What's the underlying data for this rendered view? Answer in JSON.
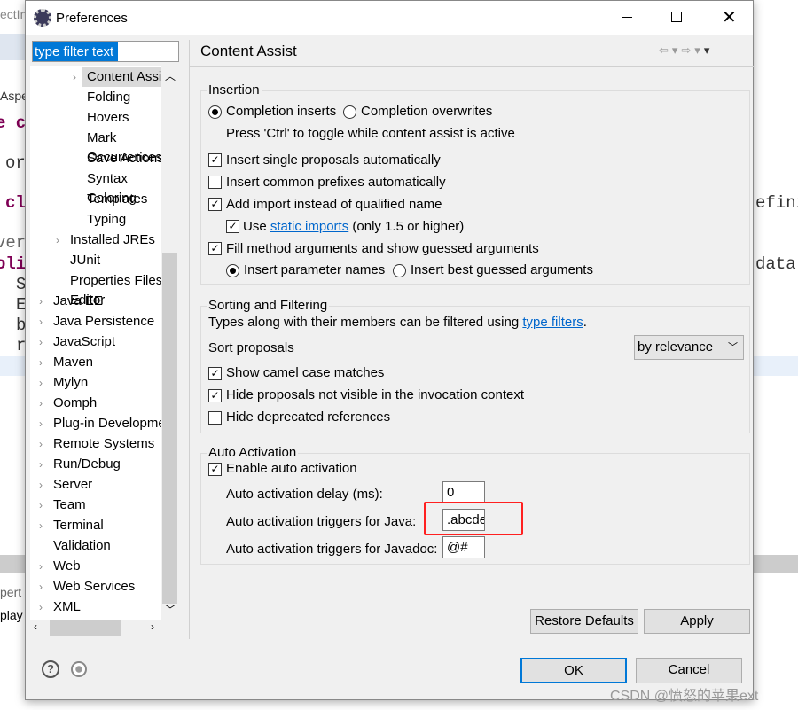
{
  "background": {
    "left_fragments": [
      "ectIn",
      "Aspe",
      "e c",
      "or",
      "cl",
      "ver",
      "oli",
      "S",
      "E",
      "b",
      "r",
      "pert",
      "play"
    ],
    "right_fragments": [
      "efini",
      "data,"
    ]
  },
  "dialog": {
    "title": "Preferences",
    "filter_placeholder": "type filter text",
    "filter_value": "type filter text"
  },
  "tree": {
    "items": [
      {
        "label": "Content Assist",
        "expandable": true,
        "selected": true
      },
      {
        "label": "Folding"
      },
      {
        "label": "Hovers"
      },
      {
        "label": "Mark Occurrences"
      },
      {
        "label": "Save Actions"
      },
      {
        "label": "Syntax Coloring"
      },
      {
        "label": "Templates"
      },
      {
        "label": "Typing"
      },
      {
        "label": "Installed JREs",
        "expandable": true
      },
      {
        "label": "JUnit"
      },
      {
        "label": "Properties Files Editor"
      },
      {
        "label": "Java EE",
        "expandable": true
      },
      {
        "label": "Java Persistence",
        "expandable": true
      },
      {
        "label": "JavaScript",
        "expandable": true
      },
      {
        "label": "Maven",
        "expandable": true
      },
      {
        "label": "Mylyn",
        "expandable": true
      },
      {
        "label": "Oomph",
        "expandable": true
      },
      {
        "label": "Plug-in Development",
        "expandable": true
      },
      {
        "label": "Remote Systems",
        "expandable": true
      },
      {
        "label": "Run/Debug",
        "expandable": true
      },
      {
        "label": "Server",
        "expandable": true
      },
      {
        "label": "Team",
        "expandable": true
      },
      {
        "label": "Terminal",
        "expandable": true
      },
      {
        "label": "Validation"
      },
      {
        "label": "Web",
        "expandable": true
      },
      {
        "label": "Web Services",
        "expandable": true
      },
      {
        "label": "XML",
        "expandable": true
      }
    ]
  },
  "page": {
    "title": "Content Assist",
    "insertion": {
      "title": "Insertion",
      "completion_inserts": "Completion inserts",
      "completion_overwrites": "Completion overwrites",
      "toggle_hint": "Press 'Ctrl' to toggle while content assist is active",
      "single_proposals": "Insert single proposals automatically",
      "common_prefixes": "Insert common prefixes automatically",
      "add_import": "Add import instead of qualified name",
      "use": "Use",
      "static_imports": "static imports",
      "only15": "(only 1.5 or higher)",
      "fill_args": "Fill method arguments and show guessed arguments",
      "insert_param_names": "Insert parameter names",
      "insert_best_guessed": "Insert best guessed arguments"
    },
    "sorting": {
      "title": "Sorting and Filtering",
      "types_text": "Types along with their members can be filtered using",
      "type_filters": "type filters",
      "period": ".",
      "sort_label": "Sort proposals",
      "sort_value": "by relevance",
      "camel_case": "Show camel case matches",
      "hide_not_visible": "Hide proposals not visible in the invocation context",
      "hide_deprecated": "Hide deprecated references"
    },
    "auto": {
      "title": "Auto Activation",
      "enable": "Enable auto activation",
      "delay_label": "Auto activation delay (ms):",
      "delay_value": "0",
      "java_label": "Auto activation triggers for Java:",
      "java_value": ".abcdefghijklmnopqrstuvwxyz",
      "javadoc_label": "Auto activation triggers for Javadoc:",
      "javadoc_value": "@#"
    },
    "restore_defaults": "Restore Defaults",
    "apply": "Apply"
  },
  "footer": {
    "ok": "OK",
    "cancel": "Cancel"
  },
  "watermark": "CSDN @愤怒的苹果ext",
  "colors": {
    "highlight": "#ff2020",
    "selection": "#0078d7",
    "link": "#0066cc"
  }
}
